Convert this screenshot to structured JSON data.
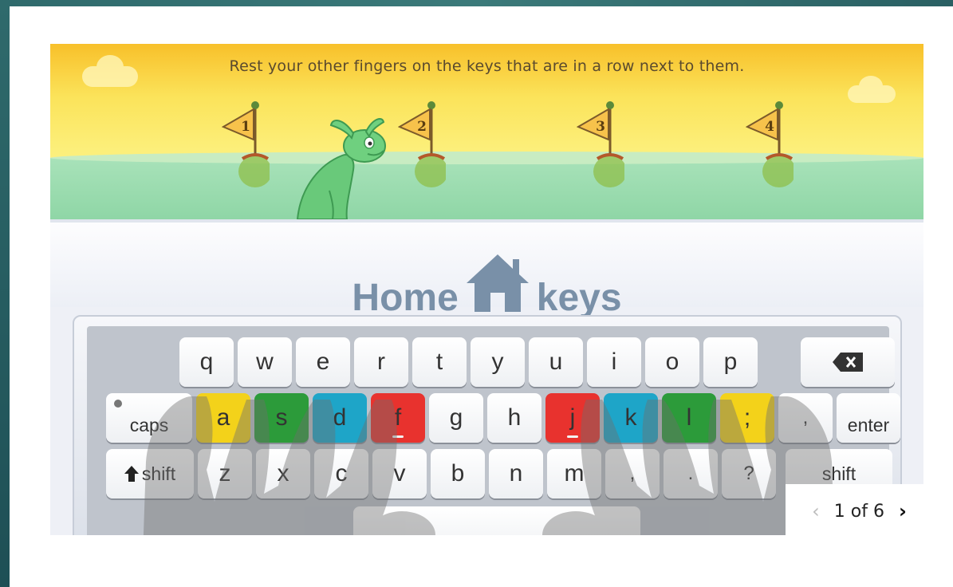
{
  "lesson": {
    "instruction": "Rest your other fingers on the keys that are in a row next to them.",
    "title_left": "Home",
    "title_right": "keys",
    "flags": [
      "1",
      "2",
      "3",
      "4"
    ]
  },
  "keyboard": {
    "row1": [
      "q",
      "w",
      "e",
      "r",
      "t",
      "y",
      "u",
      "i",
      "o",
      "p"
    ],
    "backspace_icon": "backspace-icon",
    "caps_label": "caps",
    "row2": [
      "a",
      "s",
      "d",
      "f",
      "g",
      "h",
      "j",
      "k",
      "l",
      ";",
      ","
    ],
    "enter_label": "enter",
    "shift_left_label": "shift",
    "row3": [
      "z",
      "x",
      "c",
      "v",
      "b",
      "n",
      "m",
      ",",
      ".",
      "?"
    ],
    "shift_right_label": "shift",
    "highlight_colors": {
      "yellow": "#f3d21a",
      "green": "#2c9b3a",
      "blue": "#1ea5c8",
      "red": "#e8322e"
    }
  },
  "pager": {
    "prev": "‹",
    "text": "1 of 6",
    "next": "›"
  }
}
